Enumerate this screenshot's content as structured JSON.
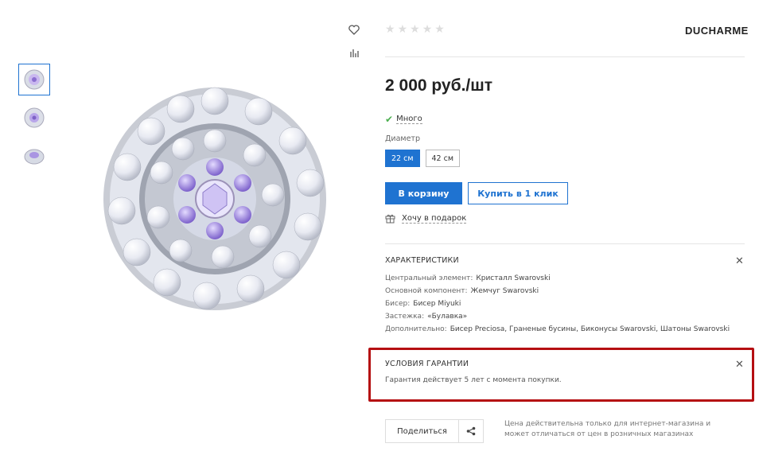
{
  "gallery": {
    "thumbnails": [
      "thumb-1",
      "thumb-2",
      "thumb-3"
    ],
    "active_index": 0
  },
  "side_icons": [
    "heart-icon",
    "compare-icon"
  ],
  "rating": {
    "value": 0,
    "max": 5
  },
  "brand": "DUCHARME",
  "price": "2 000 руб./шт",
  "stock": "Много",
  "diameter": {
    "label": "Диаметр",
    "options": [
      "22 см",
      "42 см"
    ],
    "selected": "22 см"
  },
  "buttons": {
    "cart": "В корзину",
    "one_click": "Купить в 1 клик",
    "gift": "Хочу в подарок",
    "share": "Поделиться"
  },
  "characteristics": {
    "title": "ХАРАКТЕРИСТИКИ",
    "items": [
      {
        "name": "Центральный элемент:",
        "value": "Кристалл Swarovski"
      },
      {
        "name": "Основной компонент:",
        "value": "Жемчуг Swarovski"
      },
      {
        "name": "Бисер:",
        "value": "Бисер Miyuki"
      },
      {
        "name": "Застежка:",
        "value": "«Булавка»"
      },
      {
        "name": "Дополнительно:",
        "value": "Бисер Preciosa, Граненые бусины, Биконусы Swarovski, Шатоны Swarovski"
      }
    ]
  },
  "warranty": {
    "title": "УСЛОВИЯ ГАРАНТИИ",
    "text": "Гарантия действует 5 лет с момента покупки."
  },
  "note": "Цена действительна только для интернет-магазина и может отличаться от цен в розничных магазинах",
  "colors": {
    "accent": "#1f73d1",
    "highlight_border": "#b50f12",
    "stock_check": "#4caf50"
  }
}
